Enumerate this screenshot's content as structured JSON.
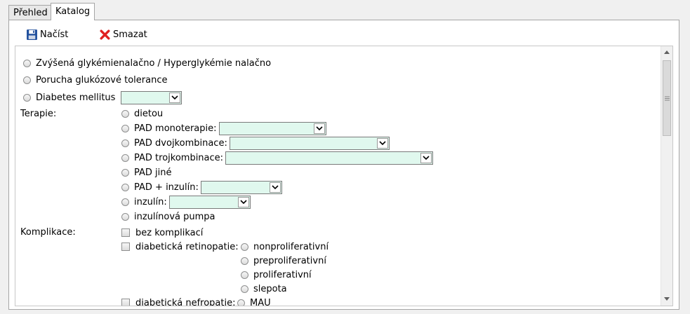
{
  "tabs": [
    {
      "label": "Přehled",
      "active": false
    },
    {
      "label": "Katalog",
      "active": true
    }
  ],
  "toolbar": {
    "load_label": "Načíst",
    "delete_label": "Smazat"
  },
  "diagnosis": {
    "options": [
      "Zvýšená glykémienalačno / Hyperglykémie nalačno",
      "Porucha glukózové tolerance",
      "Diabetes mellitus"
    ],
    "dm_type_value": ""
  },
  "therapy": {
    "label": "Terapie:",
    "options": {
      "diet": "dietou",
      "pad_mono": "PAD monoterapie:",
      "pad_dual": "PAD dvojkombinace:",
      "pad_triple": "PAD trojkombinace:",
      "pad_other": "PAD jiné",
      "pad_insulin": "PAD + inzulín:",
      "insulin": "inzulín:",
      "pump": "inzulínová pumpa"
    },
    "values": {
      "pad_mono": "",
      "pad_dual": "",
      "pad_triple": "",
      "pad_insulin": "",
      "insulin": ""
    }
  },
  "complications": {
    "label": "Komplikace:",
    "none": "bez komplikací",
    "retinopathy": {
      "label": "diabetická retinopatie:",
      "options": [
        "nonproliferativní",
        "preproliferativní",
        "proliferativní",
        "slepota"
      ]
    },
    "nephropathy": {
      "label": "diabetická nefropatie:",
      "options": [
        "MAU"
      ]
    }
  },
  "colors": {
    "select_bg": "#e0f8ee",
    "delete_icon": "#e02020",
    "save_icon": "#1f4e9c"
  }
}
